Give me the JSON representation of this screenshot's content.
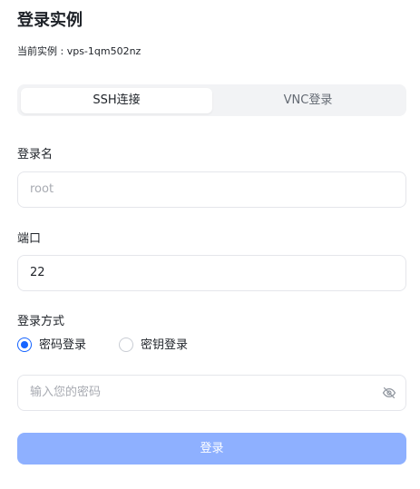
{
  "header": {
    "title": "登录实例",
    "instance_line": "当前实例 : vps-1qm502nz"
  },
  "tabs": [
    {
      "label": "SSH连接",
      "active": true
    },
    {
      "label": "VNC登录",
      "active": false
    }
  ],
  "form": {
    "username": {
      "label": "登录名",
      "value": "",
      "placeholder": "root"
    },
    "port": {
      "label": "端口",
      "value": "22"
    },
    "login_method": {
      "label": "登录方式",
      "options": [
        {
          "label": "密码登录",
          "checked": true
        },
        {
          "label": "密钥登录",
          "checked": false
        }
      ]
    },
    "password": {
      "value": "",
      "placeholder": "输入您的密码",
      "toggle_icon": "eye-off-icon"
    },
    "submit_label": "登录"
  },
  "colors": {
    "accent": "#1664ff",
    "submit_disabled": "#8eb0ff",
    "tab_track": "#f2f3f5"
  }
}
